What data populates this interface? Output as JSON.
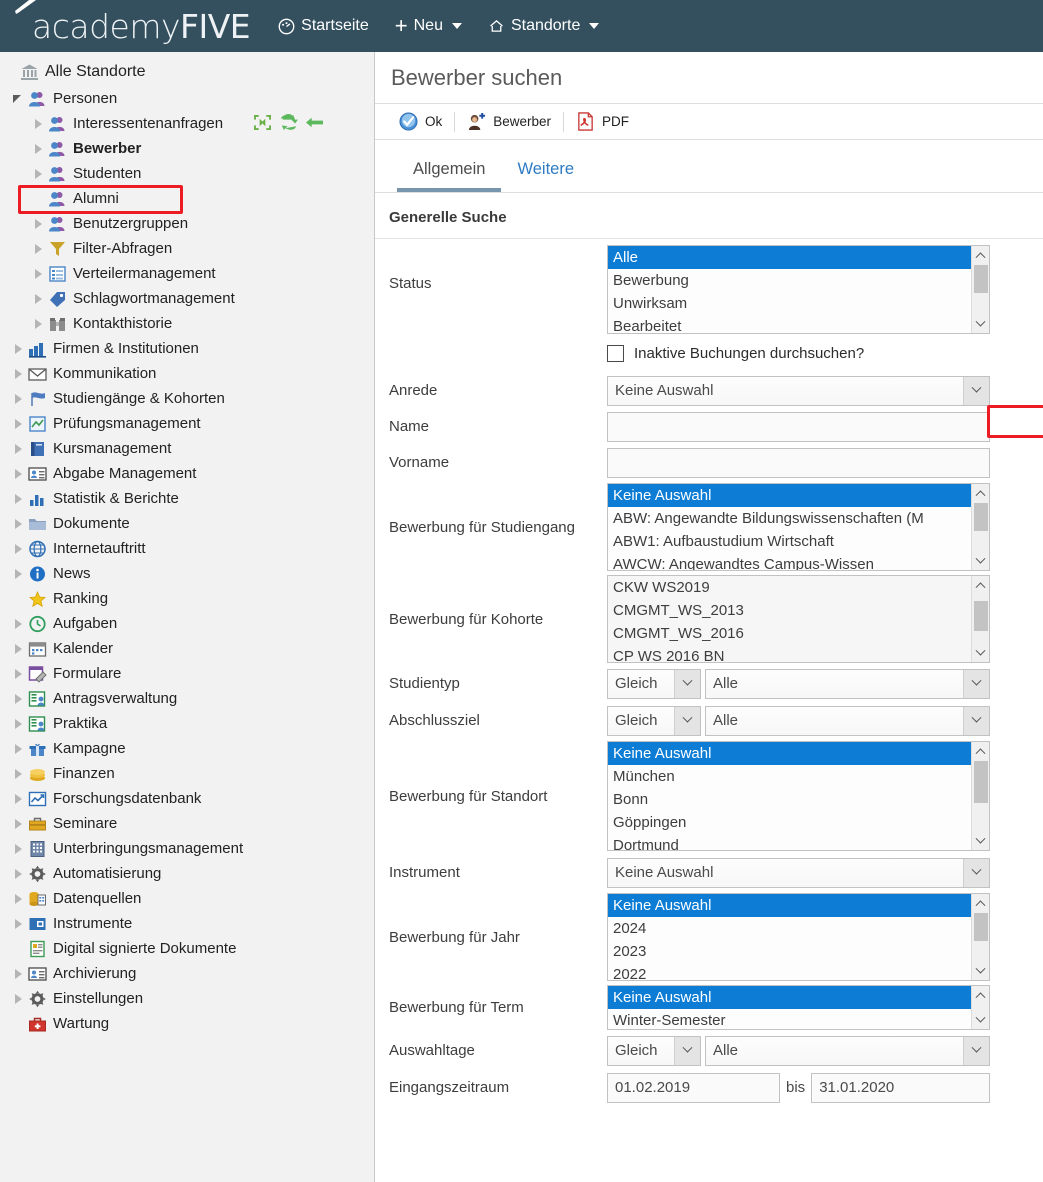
{
  "topbar": {
    "brand": "academyFIVE",
    "brand_part1": "academy",
    "brand_part2": "FIVE",
    "nav": [
      {
        "label": "Startseite",
        "icon": "dashboard-icon",
        "caret": false
      },
      {
        "label": "Neu",
        "icon": "plus-icon",
        "caret": true
      },
      {
        "label": "Standorte",
        "icon": "home-icon",
        "caret": true
      }
    ],
    "bg_color": "#34505f"
  },
  "sidebar": {
    "root": {
      "label": "Alle Standorte",
      "icon": "bank-icon"
    },
    "tools": [
      {
        "name": "collapse-all-icon",
        "title": "collapse"
      },
      {
        "name": "refresh-icon",
        "title": "refresh"
      },
      {
        "name": "back-arrow-icon",
        "title": "back"
      }
    ],
    "items": [
      {
        "label": "Personen",
        "depth": 1,
        "arrow": "open",
        "icon": "people-icon",
        "bold": false
      },
      {
        "label": "Interessentenanfragen",
        "depth": 2,
        "arrow": "closed",
        "icon": "people-icon",
        "bold": false
      },
      {
        "label": "Bewerber",
        "depth": 2,
        "arrow": "closed",
        "icon": "people-icon",
        "bold": true,
        "highlighted": true
      },
      {
        "label": "Studenten",
        "depth": 2,
        "arrow": "closed",
        "icon": "people-icon",
        "bold": false
      },
      {
        "label": "Alumni",
        "depth": 2,
        "arrow": "none",
        "icon": "people-icon",
        "bold": false
      },
      {
        "label": "Benutzergruppen",
        "depth": 2,
        "arrow": "closed",
        "icon": "people-icon",
        "bold": false
      },
      {
        "label": "Filter-Abfragen",
        "depth": 2,
        "arrow": "closed",
        "icon": "funnel-icon",
        "bold": false
      },
      {
        "label": "Verteilermanagement",
        "depth": 2,
        "arrow": "closed",
        "icon": "list-icon",
        "bold": false
      },
      {
        "label": "Schlagwortmanagement",
        "depth": 2,
        "arrow": "closed",
        "icon": "tag-icon",
        "bold": false
      },
      {
        "label": "Kontakthistorie",
        "depth": 2,
        "arrow": "closed",
        "icon": "binoculars-icon",
        "bold": false
      },
      {
        "label": "Firmen & Institutionen",
        "depth": 1,
        "arrow": "closed",
        "icon": "factory-icon",
        "bold": false
      },
      {
        "label": "Kommunikation",
        "depth": 1,
        "arrow": "closed",
        "icon": "envelope-icon",
        "bold": false
      },
      {
        "label": "Studiengänge & Kohorten",
        "depth": 1,
        "arrow": "closed",
        "icon": "flag-icon",
        "bold": false
      },
      {
        "label": "Prüfungsmanagement",
        "depth": 1,
        "arrow": "closed",
        "icon": "exam-icon",
        "bold": false
      },
      {
        "label": "Kursmanagement",
        "depth": 1,
        "arrow": "closed",
        "icon": "book-icon",
        "bold": false
      },
      {
        "label": "Abgabe Management",
        "depth": 1,
        "arrow": "closed",
        "icon": "idcard-icon",
        "bold": false
      },
      {
        "label": "Statistik & Berichte",
        "depth": 1,
        "arrow": "closed",
        "icon": "barchart-icon",
        "bold": false
      },
      {
        "label": "Dokumente",
        "depth": 1,
        "arrow": "closed",
        "icon": "folder-icon",
        "bold": false
      },
      {
        "label": "Internetauftritt",
        "depth": 1,
        "arrow": "closed",
        "icon": "globe-icon",
        "bold": false
      },
      {
        "label": "News",
        "depth": 1,
        "arrow": "closed",
        "icon": "info-icon",
        "bold": false
      },
      {
        "label": "Ranking",
        "depth": 1,
        "arrow": "none",
        "icon": "star-icon",
        "bold": false
      },
      {
        "label": "Aufgaben",
        "depth": 1,
        "arrow": "closed",
        "icon": "clock-icon",
        "bold": false
      },
      {
        "label": "Kalender",
        "depth": 1,
        "arrow": "closed",
        "icon": "calendar-icon",
        "bold": false
      },
      {
        "label": "Formulare",
        "depth": 1,
        "arrow": "closed",
        "icon": "form-icon",
        "bold": false
      },
      {
        "label": "Antragsverwaltung",
        "depth": 1,
        "arrow": "closed",
        "icon": "application-icon",
        "bold": false
      },
      {
        "label": "Praktika",
        "depth": 1,
        "arrow": "closed",
        "icon": "application-icon",
        "bold": false
      },
      {
        "label": "Kampagne",
        "depth": 1,
        "arrow": "closed",
        "icon": "gift-icon",
        "bold": false
      },
      {
        "label": "Finanzen",
        "depth": 1,
        "arrow": "closed",
        "icon": "coins-icon",
        "bold": false
      },
      {
        "label": "Forschungsdatenbank",
        "depth": 1,
        "arrow": "closed",
        "icon": "research-icon",
        "bold": false
      },
      {
        "label": "Seminare",
        "depth": 1,
        "arrow": "closed",
        "icon": "briefcase-icon",
        "bold": false
      },
      {
        "label": "Unterbringungsmanagement",
        "depth": 1,
        "arrow": "closed",
        "icon": "building-icon",
        "bold": false
      },
      {
        "label": "Automatisierung",
        "depth": 1,
        "arrow": "closed",
        "icon": "gear-icon",
        "bold": false
      },
      {
        "label": "Datenquellen",
        "depth": 1,
        "arrow": "closed",
        "icon": "database-icon",
        "bold": false
      },
      {
        "label": "Instrumente",
        "depth": 1,
        "arrow": "closed",
        "icon": "instrument-icon",
        "bold": false
      },
      {
        "label": "Digital signierte Dokumente",
        "depth": 1,
        "arrow": "none",
        "icon": "signed-doc-icon",
        "bold": false
      },
      {
        "label": "Archivierung",
        "depth": 1,
        "arrow": "closed",
        "icon": "idcard-icon",
        "bold": false
      },
      {
        "label": "Einstellungen",
        "depth": 1,
        "arrow": "closed",
        "icon": "gear-icon",
        "bold": false
      },
      {
        "label": "Wartung",
        "depth": 1,
        "arrow": "none",
        "icon": "toolbox-icon",
        "bold": false
      }
    ]
  },
  "page": {
    "title": "Bewerber suchen",
    "toolbar": [
      {
        "label": "Ok",
        "icon": "check-circle-icon"
      },
      {
        "label": "Bewerber",
        "icon": "add-person-icon"
      },
      {
        "label": "PDF",
        "icon": "pdf-icon"
      }
    ],
    "tabs": [
      {
        "label": "Allgemein",
        "active": true
      },
      {
        "label": "Weitere",
        "active": false
      }
    ],
    "section_title": "Generelle Suche"
  },
  "form": {
    "status": {
      "label": "Status",
      "options": [
        "Alle",
        "Bewerbung",
        "Unwirksam",
        "Bearbeitet"
      ],
      "selected": "Alle"
    },
    "inaktive_checkbox": {
      "label": "Inaktive Buchungen durchsuchen?",
      "checked": false,
      "highlighted": true
    },
    "anrede": {
      "label": "Anrede",
      "value": "Keine Auswahl"
    },
    "name": {
      "label": "Name",
      "value": "",
      "placeholder": ""
    },
    "vorname": {
      "label": "Vorname",
      "value": "",
      "placeholder": ""
    },
    "studiengang": {
      "label": "Bewerbung für Studiengang",
      "options": [
        "Keine Auswahl",
        "ABW: Angewandte Bildungswissenschaften (M",
        "ABW1: Aufbaustudium Wirtschaft",
        "AWCW: Angewandtes Campus-Wissen"
      ],
      "selected": "Keine Auswahl"
    },
    "kohorte": {
      "label": "Bewerbung für Kohorte",
      "options": [
        "CKW WS2019",
        "CMGMT_WS_2013",
        "CMGMT_WS_2016",
        "CP WS 2016 BN"
      ],
      "selected": null
    },
    "studientyp": {
      "label": "Studientyp",
      "operator": "Gleich",
      "value": "Alle"
    },
    "abschlussziel": {
      "label": "Abschlussziel",
      "operator": "Gleich",
      "value": "Alle"
    },
    "standort": {
      "label": "Bewerbung für Standort",
      "options": [
        "Keine Auswahl",
        "München",
        "Bonn",
        "Göppingen",
        "Dortmund"
      ],
      "selected": "Keine Auswahl"
    },
    "instrument": {
      "label": "Instrument",
      "value": "Keine Auswahl"
    },
    "jahr": {
      "label": "Bewerbung für Jahr",
      "options": [
        "Keine Auswahl",
        "2024",
        "2023",
        "2022"
      ],
      "selected": "Keine Auswahl"
    },
    "term": {
      "label": "Bewerbung für Term",
      "options": [
        "Keine Auswahl",
        "Winter-Semester"
      ],
      "selected": "Keine Auswahl"
    },
    "auswahltage": {
      "label": "Auswahltage",
      "operator": "Gleich",
      "value": "Alle"
    },
    "eingangszeitraum": {
      "label": "Eingangszeitraum",
      "from": "01.02.2019",
      "separator": "bis",
      "to": "31.01.2020"
    }
  },
  "colors": {
    "header_bg": "#34505f",
    "selection_blue": "#0c7cd5",
    "highlight_red": "#ec1c24",
    "tab_link_blue": "#2e7bc4",
    "tab_underline": "#7796ae"
  }
}
